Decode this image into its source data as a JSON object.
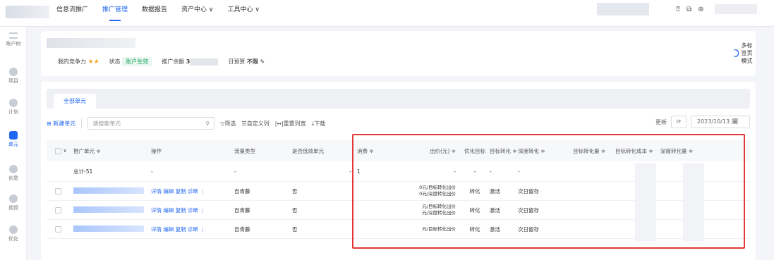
{
  "topbar": {
    "nav": [
      "信息流推广",
      "推广管理",
      "数据报告",
      "资产中心 ∨",
      "工具中心 ∨"
    ],
    "active_index": 1,
    "icons": [
      "help-icon",
      "copy-icon",
      "user-icon"
    ]
  },
  "sidebar": {
    "items": [
      "账户树",
      "项目",
      "计划",
      "单元",
      "创意",
      "视频",
      "优化"
    ],
    "active_index": 3
  },
  "info": {
    "competitiveness_label": "我的竞争力",
    "stars": "★★",
    "status_label": "状态",
    "status_value": "账户生效",
    "balance_label": "推广余额",
    "balance_prefix": "3",
    "budget_label": "日预算",
    "budget_value": "不限",
    "multi_tab_label": "多标签页模式"
  },
  "tabs": {
    "all_units": "全部单元"
  },
  "toolbar": {
    "new_unit": "新建单元",
    "search_placeholder": "请搜索单元",
    "filter": "筛选",
    "customize_columns": "自定义列",
    "reset_width": "重置列宽",
    "download": "下载",
    "refresh_label": "更新",
    "date": "2023/10/13"
  },
  "table": {
    "headers": [
      "推广单元 ≑",
      "操作",
      "流量类型",
      "是否低效单元",
      "消费 ≑",
      "出价(元) ≑",
      "优化目标",
      "目标转化 ≑",
      "深度转化 ≑",
      "目标转化量 ≑",
      "目标转化成本 ≑",
      "深度转化量 ≑"
    ],
    "total_label": "总计-51",
    "total_dash": "-",
    "total_cost": "1",
    "rows": [
      {
        "ops": "详情 编辑 复制 诊断 ⋮",
        "traffic": "百青藤",
        "low": "否",
        "bid1": "0元/目标转化出价",
        "bid2": "0元/深度转化出价",
        "goal": "转化",
        "goal_conv": "激活",
        "deep": "次日留存"
      },
      {
        "ops": "详情 编辑 复制 诊断 ⋮",
        "traffic": "百青藤",
        "low": "否",
        "bid1": "元/目标转化出价",
        "bid2": "元/深度转化出价",
        "goal": "转化",
        "goal_conv": "激活",
        "deep": "次日留存"
      },
      {
        "ops": "详情 编辑 复制 诊断 ⋮",
        "traffic": "百青藤",
        "low": "否",
        "bid1": "元/目标转化出价",
        "bid2": "",
        "goal": "转化",
        "goal_conv": "激活",
        "deep": "次日留存"
      }
    ]
  },
  "colors": {
    "accent": "#1f66f2",
    "highlight_box": "#e33838",
    "status_green": "#1aa260",
    "star": "#f5a623"
  }
}
